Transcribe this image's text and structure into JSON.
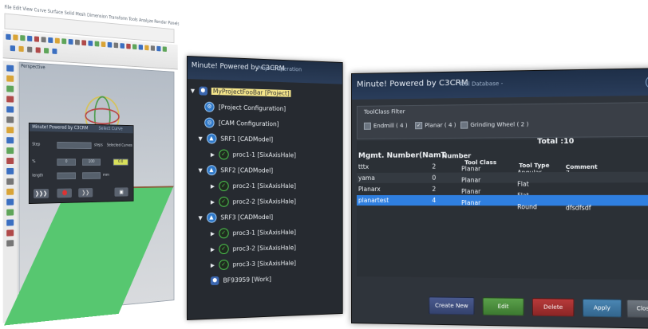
{
  "cad": {
    "menu": "File  Edit  View  Curve  Surface  Solid  Mesh  Dimension  Transform  Tools  Analyze  Render  Panels  Help",
    "viewport_label": "Perspective",
    "dialog": {
      "title": "Minute! Powered by C3CRM",
      "subtitle": "Select Curve",
      "step_label": "Step",
      "steps_label": "steps",
      "selected_curves_label": "Selected Curves",
      "pct_label": "%",
      "pct_value1": "0",
      "pct_value2": "100",
      "length_label": "length",
      "length_unit": "mm",
      "value_field": "0.0"
    }
  },
  "tree": {
    "title": "Minute! Powered by C3CRM",
    "subtitle": "Project Operation",
    "nodes": [
      {
        "label": "MyProjectFooBar [Project]"
      },
      {
        "label": "[Project Configuration]"
      },
      {
        "label": "[CAM Configuration]"
      },
      {
        "label": "SRF1 [CADModel]"
      },
      {
        "label": "proc1-1 [SixAxisHale]"
      },
      {
        "label": "SRF2 [CADModel]"
      },
      {
        "label": "proc2-1 [SixAxisHale]"
      },
      {
        "label": "proc2-2 [SixAxisHale]"
      },
      {
        "label": "SRF3 [CADModel]"
      },
      {
        "label": "proc3-1 [SixAxisHale]"
      },
      {
        "label": "proc3-2 [SixAxisHale]"
      },
      {
        "label": "proc3-3 [SixAxisHale]"
      },
      {
        "label": "BF93959 [Work]"
      }
    ]
  },
  "tooldb": {
    "title": "Minute! Powered by C3CRM",
    "subtitle": "- Tool Database -",
    "help_icon": "?",
    "filter_title": "ToolClass Filter",
    "filters": [
      {
        "label": "Endmill ( 4 )",
        "checked": false
      },
      {
        "label": "Planar ( 4 )",
        "checked": true
      },
      {
        "label": "Grinding Wheel ( 2 )",
        "checked": false
      }
    ],
    "total": "Total :10",
    "columns": {
      "mgmt": "Mgmt. Number(NamT",
      "number": "Number",
      "toolclass": "Tool Class",
      "tooltype": "Tool Type",
      "comment": "Comment"
    },
    "rows": [
      {
        "name": "tttx",
        "num": "2",
        "cls": "Planar",
        "type": "Angular",
        "comment": "7"
      },
      {
        "name": "yama",
        "num": "0",
        "cls": "Planar",
        "type": "Flat",
        "comment": ""
      },
      {
        "name": "Planarx",
        "num": "2",
        "cls": "Planar",
        "type": "Flat",
        "comment": ""
      },
      {
        "name": "planartest",
        "num": "4",
        "cls": "Planar",
        "type": "Round",
        "comment": "dfsdfsdf"
      }
    ],
    "buttons": {
      "create_new": "Create New",
      "edit": "Edit",
      "delete": "Delete",
      "apply": "Apply",
      "close": "Close"
    }
  }
}
